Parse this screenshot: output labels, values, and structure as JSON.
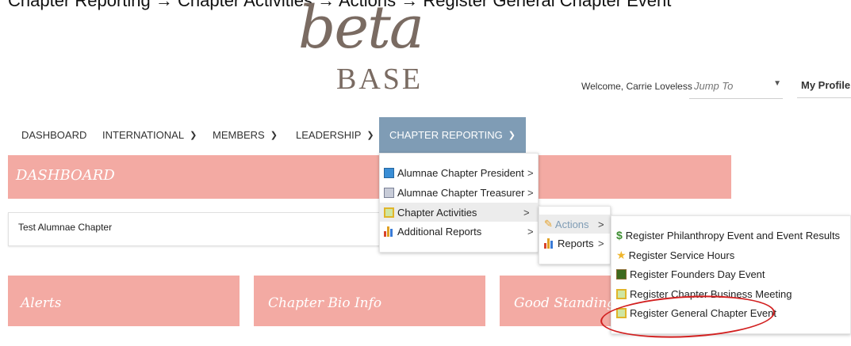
{
  "caption": "Chapter Reporting → Chapter Activities → Actions → Register General Chapter Event",
  "logo": {
    "top": "beta",
    "bottom": "BASE"
  },
  "header": {
    "welcome": "Welcome, Carrie Loveless",
    "jump_placeholder": "Jump To",
    "profile": "My Profile"
  },
  "nav": {
    "dashboard": "DASHBOARD",
    "international": "INTERNATIONAL",
    "members": "MEMBERS",
    "leadership": "LEADERSHIP",
    "chapter_reporting": "CHAPTER REPORTING"
  },
  "dashboard_title": "DASHBOARD",
  "chapter_name": "Test Alumnae Chapter",
  "cards": {
    "alerts": "Alerts",
    "bio": "Chapter Bio Info",
    "standing": "Good Standing"
  },
  "menu1": {
    "president": "Alumnae Chapter President",
    "treasurer": "Alumnae Chapter Treasurer",
    "activities": "Chapter Activities",
    "additional": "Additional Reports"
  },
  "menu2": {
    "actions": "Actions",
    "reports": "Reports"
  },
  "menu3": {
    "philanthropy": "Register Philanthropy Event and Event Results",
    "service": "Register Service Hours",
    "founders": "Register Founders Day Event",
    "business": "Register Chapter Business Meeting",
    "general": "Register General Chapter Event"
  },
  "colors": {
    "nav_active": "#7f9cb5",
    "banner_pink": "#f3aaa3",
    "highlight_circle": "#d22020"
  }
}
